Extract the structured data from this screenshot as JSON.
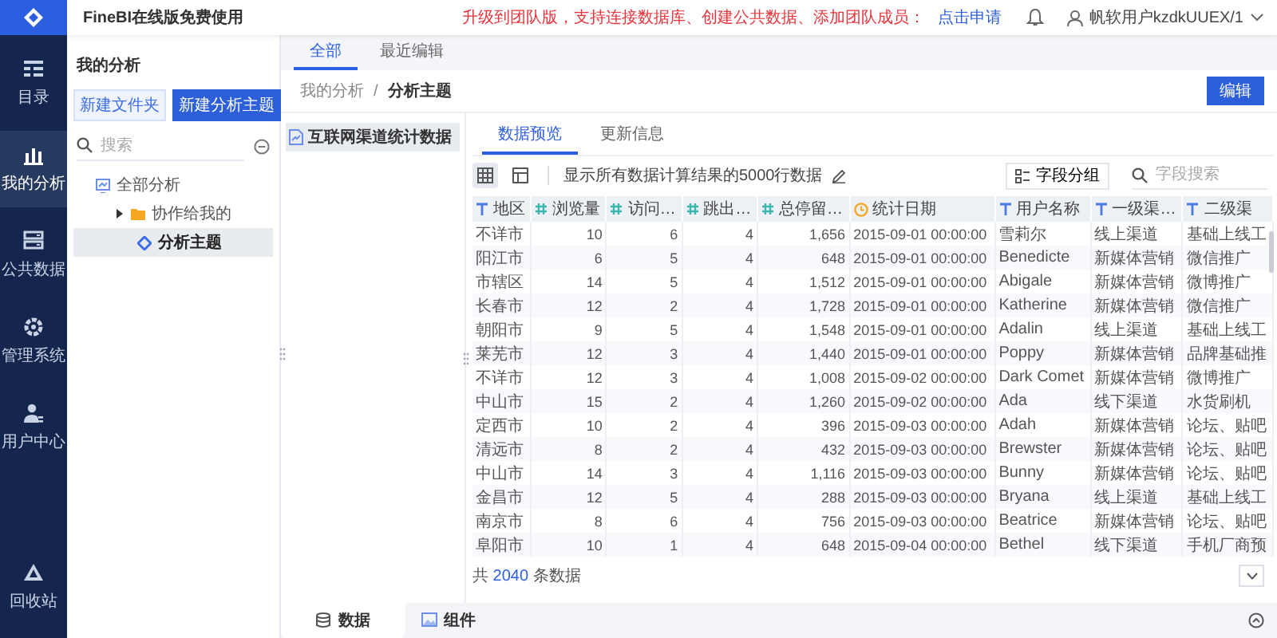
{
  "nav": {
    "items": [
      {
        "label": "目录",
        "selected": false
      },
      {
        "label": "我的分析",
        "selected": true
      },
      {
        "label": "公共数据",
        "selected": false
      },
      {
        "label": "管理系统",
        "selected": false
      },
      {
        "label": "用户中心",
        "selected": false
      }
    ],
    "bottom": {
      "label": "回收站"
    }
  },
  "topbar": {
    "title": "FineBI在线版免费使用",
    "notice": "升级到团队版，支持连接数据库、创建公共数据、添加团队成员：",
    "notice_link": "点击申请",
    "user": "帆软用户kzdkUUEX/1"
  },
  "tree_panel": {
    "title": "我的分析",
    "buttons": [
      {
        "label": "新建文件夹",
        "kind": "secondary"
      },
      {
        "label": "新建分析主题",
        "kind": "primary"
      }
    ],
    "search": {
      "placeholder": "搜索"
    },
    "tree": [
      {
        "label": "全部分析",
        "kind": "root",
        "selected": false,
        "children": [
          {
            "label": "协作给我的",
            "kind": "folder",
            "expanded": false,
            "selected": false
          },
          {
            "label": "分析主题",
            "kind": "subject",
            "selected": true
          }
        ]
      }
    ]
  },
  "tabs": [
    {
      "label": "全部",
      "selected": true
    },
    {
      "label": "最近编辑",
      "selected": false
    }
  ],
  "breadcrumb": {
    "items": [
      "我的分析",
      "分析主题"
    ],
    "separator": "/"
  },
  "edit_button": "编辑",
  "datasets": [
    {
      "label": "互联网渠道统计数据",
      "selected": true
    }
  ],
  "detail_tabs": [
    {
      "label": "数据预览",
      "selected": true
    },
    {
      "label": "更新信息",
      "selected": false
    }
  ],
  "toolbar": {
    "views": [
      {
        "selected": true
      },
      {
        "selected": false
      }
    ],
    "info": "显示所有数据计算结果的5000行数据",
    "group_button": "字段分组",
    "search": {
      "placeholder": "字段搜索"
    }
  },
  "table": {
    "columns": [
      {
        "label": "地区",
        "kind": "text"
      },
      {
        "label": "浏览量",
        "kind": "number"
      },
      {
        "label": "访问…",
        "kind": "number"
      },
      {
        "label": "跳出…",
        "kind": "number"
      },
      {
        "label": "总停留…",
        "kind": "number"
      },
      {
        "label": "统计日期",
        "kind": "date"
      },
      {
        "label": "用户名称",
        "kind": "text"
      },
      {
        "label": "一级渠…",
        "kind": "text"
      },
      {
        "label": "二级渠",
        "kind": "text"
      }
    ],
    "rows": [
      [
        "不详市",
        "10",
        "6",
        "4",
        "1,656",
        "2015-09-01 00:00:00",
        "雪莉尔",
        "线上渠道",
        "基础上线工"
      ],
      [
        "阳江市",
        "6",
        "5",
        "4",
        "648",
        "2015-09-01 00:00:00",
        "Benedicte",
        "新媒体营销",
        "微信推广"
      ],
      [
        "市辖区",
        "14",
        "5",
        "4",
        "1,512",
        "2015-09-01 00:00:00",
        "Abigale",
        "新媒体营销",
        "微博推广"
      ],
      [
        "长春市",
        "12",
        "2",
        "4",
        "1,728",
        "2015-09-01 00:00:00",
        "Katherine",
        "新媒体营销",
        "微信推广"
      ],
      [
        "朝阳市",
        "9",
        "5",
        "4",
        "1,548",
        "2015-09-01 00:00:00",
        "Adalin",
        "线上渠道",
        "基础上线工"
      ],
      [
        "莱芜市",
        "12",
        "3",
        "4",
        "1,440",
        "2015-09-01 00:00:00",
        "Poppy",
        "新媒体营销",
        "品牌基础推"
      ],
      [
        "不详市",
        "12",
        "3",
        "4",
        "1,008",
        "2015-09-02 00:00:00",
        "Dark Comet",
        "新媒体营销",
        "微博推广"
      ],
      [
        "中山市",
        "15",
        "2",
        "4",
        "1,260",
        "2015-09-02 00:00:00",
        "Ada",
        "线下渠道",
        "水货刷机"
      ],
      [
        "定西市",
        "10",
        "2",
        "4",
        "396",
        "2015-09-03 00:00:00",
        "Adah",
        "新媒体营销",
        "论坛、贴吧"
      ],
      [
        "清远市",
        "8",
        "2",
        "4",
        "432",
        "2015-09-03 00:00:00",
        "Brewster",
        "新媒体营销",
        "论坛、贴吧"
      ],
      [
        "中山市",
        "14",
        "3",
        "4",
        "1,116",
        "2015-09-03 00:00:00",
        "Bunny",
        "新媒体营销",
        "论坛、贴吧"
      ],
      [
        "金昌市",
        "12",
        "5",
        "4",
        "288",
        "2015-09-03 00:00:00",
        "Bryana",
        "线上渠道",
        "基础上线工"
      ],
      [
        "南京市",
        "8",
        "6",
        "4",
        "756",
        "2015-09-03 00:00:00",
        "Beatrice",
        "新媒体营销",
        "论坛、贴吧"
      ],
      [
        "阜阳市",
        "10",
        "1",
        "4",
        "648",
        "2015-09-04 00:00:00",
        "Bethel",
        "线下渠道",
        "手机厂商预"
      ]
    ]
  },
  "footer": {
    "prefix": "共",
    "count": "2040",
    "suffix": "条数据"
  },
  "bottom_tabs": [
    {
      "label": "数据",
      "selected": true
    },
    {
      "label": "组件",
      "selected": false
    }
  ]
}
